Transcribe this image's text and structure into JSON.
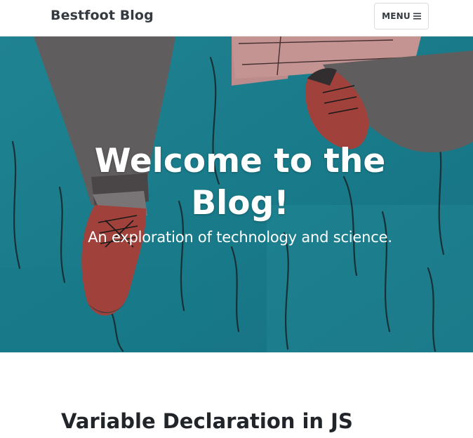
{
  "navbar": {
    "brand": "Bestfoot Blog",
    "menu_label": "MENU",
    "menu_icon": "hamburger-icon"
  },
  "hero": {
    "title": "Welcome to the Blog!",
    "subtitle": "An exploration of technology and science.",
    "background_image": "illustration of two feet in red sneakers over teal water"
  },
  "posts": [
    {
      "title": "Variable Declaration in JS"
    }
  ],
  "colors": {
    "brand_text": "#343a40",
    "hero_water": "#1f8fa0",
    "sneaker_red": "#b94a45"
  }
}
